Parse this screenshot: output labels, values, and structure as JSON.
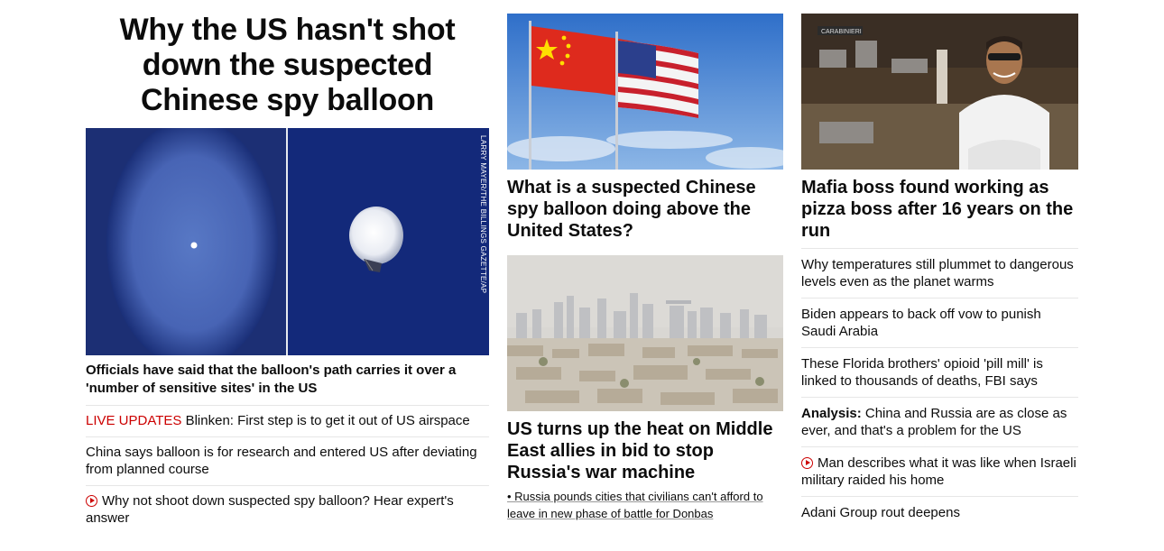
{
  "hero": {
    "title": "Why the US hasn't shot down the suspected Chinese spy balloon",
    "image_credit": "LARRY MAYER/THE BILLINGS GAZETTE/AP",
    "lead": "Officials have said that the balloon's path carries it over a 'number of sensitive sites' in the US",
    "items": [
      {
        "prefix": "LIVE UPDATES",
        "text": " Blinken: First step is to get it out of US airspace"
      },
      {
        "text": "China says balloon is for research and entered US after deviating from planned course"
      },
      {
        "text": "Why not shoot down suspected spy balloon? Hear expert's answer",
        "icon": "play-icon"
      }
    ]
  },
  "middle": {
    "card1": {
      "title": "What is a suspected Chinese spy balloon doing above the United States?"
    },
    "card2": {
      "title": "US turns up the heat on Middle East allies in bid to stop Russia's war machine",
      "bullet": "• Russia pounds cities that civilians can't afford to leave in new phase of battle for Donbas"
    }
  },
  "right": {
    "card": {
      "title": "Mafia boss found working as pizza boss after 16 years on the run"
    },
    "items": [
      {
        "text": "Why temperatures still plummet to dangerous levels even as the planet warms"
      },
      {
        "text": "Biden appears to back off vow to punish Saudi Arabia"
      },
      {
        "text": "These Florida brothers' opioid 'pill mill' is linked to thousands of deaths, FBI says"
      },
      {
        "label": "Analysis:",
        "text": " China and Russia are as close as ever, and that's a problem for the US"
      },
      {
        "text": "Man describes what it was like when Israeli military raided his home",
        "icon": "play-icon"
      },
      {
        "text": "Adani Group rout deepens"
      }
    ]
  },
  "colors": {
    "accent_red": "#cc0000",
    "divider": "#e6e6e6"
  }
}
